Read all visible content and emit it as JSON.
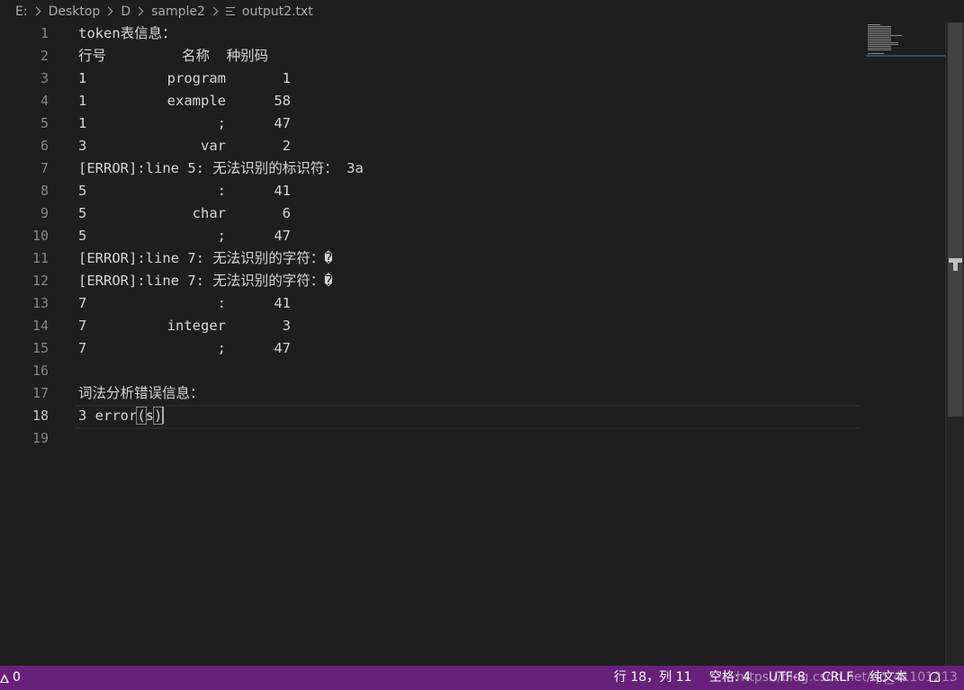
{
  "breadcrumb": {
    "items": [
      "E:",
      "Desktop",
      "D",
      "sample2"
    ],
    "file": "output2.txt"
  },
  "editor": {
    "lines": [
      {
        "n": "1",
        "text": "token表信息："
      },
      {
        "n": "2",
        "text": "行号         名称  种别码"
      },
      {
        "n": "3",
        "cols": [
          "1",
          "program",
          "1"
        ]
      },
      {
        "n": "4",
        "cols": [
          "1",
          "example",
          "58"
        ]
      },
      {
        "n": "5",
        "cols": [
          "1",
          ";",
          "47"
        ]
      },
      {
        "n": "6",
        "cols": [
          "3",
          "var",
          "2"
        ]
      },
      {
        "n": "7",
        "text": "[ERROR]:line 5: 无法识别的标识符： 3a"
      },
      {
        "n": "8",
        "cols": [
          "5",
          ":",
          "41"
        ]
      },
      {
        "n": "9",
        "cols": [
          "5",
          "char",
          "6"
        ]
      },
      {
        "n": "10",
        "cols": [
          "5",
          ";",
          "47"
        ]
      },
      {
        "n": "11",
        "text": "[ERROR]:line 7: 无法识别的字符：�"
      },
      {
        "n": "12",
        "text": "[ERROR]:line 7: 无法识别的字符：�"
      },
      {
        "n": "13",
        "cols": [
          "7",
          ":",
          "41"
        ]
      },
      {
        "n": "14",
        "cols": [
          "7",
          "integer",
          "3"
        ]
      },
      {
        "n": "15",
        "cols": [
          "7",
          ";",
          "47"
        ]
      },
      {
        "n": "16",
        "text": ""
      },
      {
        "n": "17",
        "text": "词法分析错误信息："
      },
      {
        "n": "18",
        "pre": "3 error",
        "open": "(",
        "mid": "s",
        "close": ")"
      },
      {
        "n": "19",
        "text": ""
      }
    ]
  },
  "statusbar": {
    "warnings": "0",
    "position": "行 18，列 11",
    "indent": "空格: 4",
    "encoding": "UTF-8",
    "eol": "CRLF",
    "language": "纯文本",
    "watermark": "https://blog.csdn.net/qq_41101213"
  },
  "colors": {
    "editor_bg": "#1e1e1e",
    "statusbar_bg": "#68217a",
    "text": "#d4d4d4",
    "line_number": "#858585"
  }
}
